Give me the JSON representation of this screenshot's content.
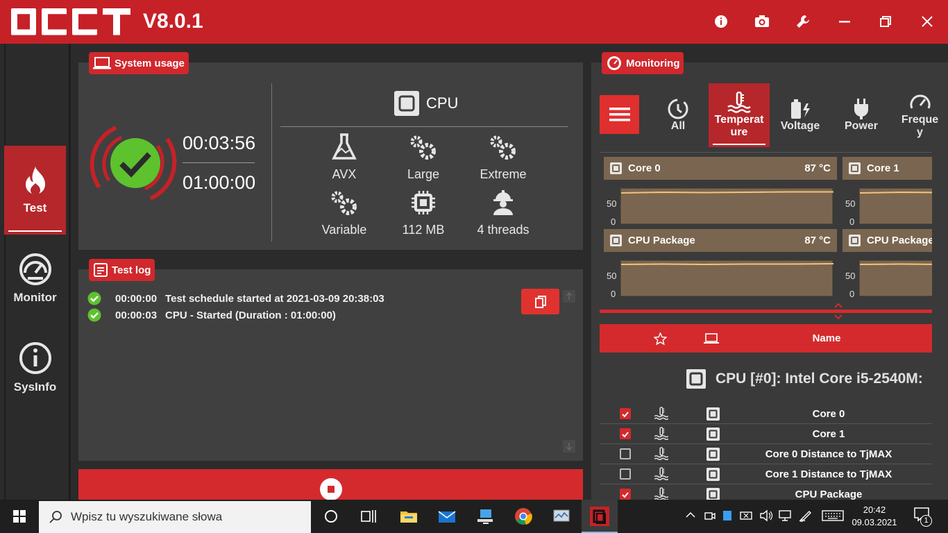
{
  "app": {
    "logo": "OCCT",
    "version": "V8.0.1"
  },
  "window_buttons": [
    "info-icon",
    "camera-icon",
    "wrench-icon",
    "minimize-icon",
    "restore-icon",
    "close-icon"
  ],
  "nav": [
    {
      "label": "Test",
      "icon": "flame-icon",
      "active": true
    },
    {
      "label": "Monitor",
      "icon": "gauge-icon",
      "active": false
    },
    {
      "label": "SysInfo",
      "icon": "info-icon",
      "active": false
    }
  ],
  "system_usage": {
    "tag": "System usage",
    "elapsed": "00:03:56",
    "duration": "01:00:00",
    "test_type": "CPU",
    "specs": [
      {
        "icon": "flask-icon",
        "label": "AVX"
      },
      {
        "icon": "gears-icon",
        "label": "Large"
      },
      {
        "icon": "gears-icon",
        "label": "Extreme"
      },
      {
        "icon": "gears-icon",
        "label": "Variable"
      },
      {
        "icon": "chip-icon",
        "label": "112 MB"
      },
      {
        "icon": "worker-icon",
        "label": "4 threads"
      }
    ]
  },
  "test_log": {
    "tag": "Test log",
    "entries": [
      {
        "time": "00:00:00",
        "message": "Test schedule started at 2021-03-09 20:38:03"
      },
      {
        "time": "00:00:03",
        "message": "CPU - Started (Duration : 01:00:00)"
      }
    ]
  },
  "monitoring": {
    "tag": "Monitoring",
    "tabs": [
      {
        "label": "All",
        "icon": "clock-icon"
      },
      {
        "label": "Temperature",
        "label_lines": [
          "Temperat",
          "ure"
        ],
        "icon": "thermometer-icon",
        "active": true
      },
      {
        "label": "Voltage",
        "icon": "battery-icon"
      },
      {
        "label": "Power",
        "icon": "plug-icon"
      },
      {
        "label": "Frequency",
        "label_lines": [
          "Freque",
          "y"
        ],
        "icon": "speedometer-icon"
      }
    ],
    "charts": [
      {
        "name": "Core 0",
        "value": "87 °C"
      },
      {
        "name": "Core 1",
        "value": ""
      },
      {
        "name": "CPU Package",
        "value": "87 °C"
      },
      {
        "name": "CPU Package",
        "value": ""
      }
    ],
    "y_ticks": [
      "50",
      "0"
    ],
    "table_header": {
      "name": "Name"
    },
    "device": "CPU [#0]: Intel Core i5-2540M:",
    "sensors": [
      {
        "name": "Core 0",
        "checked": true
      },
      {
        "name": "Core 1",
        "checked": true
      },
      {
        "name": "Core 0 Distance to TjMAX",
        "checked": false
      },
      {
        "name": "Core 1 Distance to TjMAX",
        "checked": false
      },
      {
        "name": "CPU Package",
        "checked": true
      }
    ]
  },
  "taskbar": {
    "search_placeholder": "Wpisz tu wyszukiwane słowa",
    "time": "20:42",
    "date": "09.03.2021",
    "notification_count": "1"
  }
}
